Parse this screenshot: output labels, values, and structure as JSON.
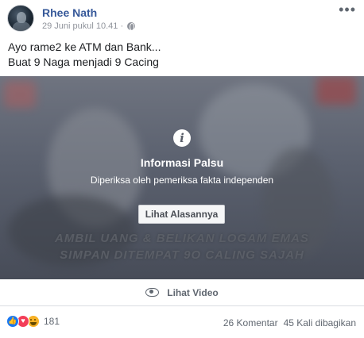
{
  "post": {
    "author": "Rhee Nath",
    "timestamp": "29 Juni pukul 10.41 ·",
    "privacy_icon": "globe-icon",
    "more_label": "•••",
    "text_line_1": "Ayo rame2 ke ATM dan Bank...",
    "text_line_2": "Buat 9 Naga menjadi 9 Cacing"
  },
  "media": {
    "watermark_line_1": "AMBIL UANG & BELIKAN LOGAM EMAS",
    "watermark_line_2": "SIMPAN DITEMPAT 9O CALING SAJAH",
    "info_icon_glyph": "i",
    "overlay_title": "Informasi Palsu",
    "overlay_subtitle": "Diperiksa oleh pemeriksa fakta independen",
    "see_why_label": "Lihat Alasannya"
  },
  "see_video": {
    "label": "Lihat Video",
    "icon": "eye-icon"
  },
  "footer": {
    "reaction_count": "181",
    "comments": "26 Komentar",
    "shares": "45 Kali dibagikan",
    "reaction_icons": [
      "like-icon",
      "love-icon",
      "haha-icon"
    ]
  },
  "colors": {
    "author_link": "#365899",
    "meta_grey": "#90949c",
    "like_blue": "#1877f2",
    "love_red": "#f33e58",
    "haha_yellow": "#f7b125"
  }
}
